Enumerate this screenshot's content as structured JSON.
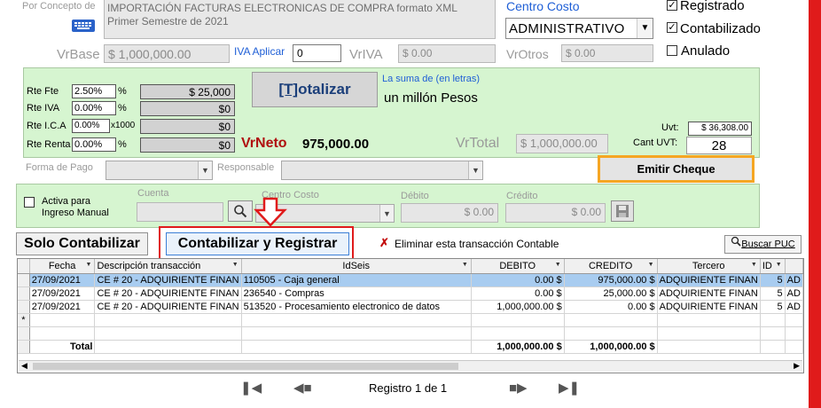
{
  "concepto": {
    "label": "Por Concepto de",
    "text_line1": "IMPORTACIÓN FACTURAS ELECTRONICAS DE COMPRA formato XML",
    "text_line2": "Primer Semestre de 2021",
    "keyboard_icon": "keyboard-icon"
  },
  "centro_costo_header": {
    "label": "Centro Costo",
    "value": "ADMINISTRATIVO"
  },
  "flags": {
    "registrado": {
      "label": "Registrado",
      "checked": true
    },
    "contabilizado": {
      "label": "Contabilizado",
      "checked": true
    },
    "anulado": {
      "label": "Anulado",
      "checked": false
    }
  },
  "base_row": {
    "vrbase_label": "VrBase",
    "vrbase_value": "$ 1,000,000.00",
    "iva_aplicar_label": "IVA Aplicar",
    "iva_aplicar_value": "0",
    "vriva_label": "VrIVA",
    "vriva_value": "$ 0.00",
    "vrotros_label": "VrOtros",
    "vrotros_value": "$ 0.00"
  },
  "retenciones": {
    "rte_fte": {
      "label": "Rte Fte",
      "pct": "2.50%",
      "unit": "%",
      "value": "$ 25,000"
    },
    "rte_iva": {
      "label": "Rte IVA",
      "pct": "0.00%",
      "unit": "%",
      "value": "$0"
    },
    "rte_ica": {
      "label": "Rte I.C.A",
      "pct": "0.00%",
      "unit": "x1000",
      "value": "$0"
    },
    "rte_renta": {
      "label": "Rte Renta",
      "pct": "0.00%",
      "unit": "%",
      "value": "$0"
    }
  },
  "totalizar_button": {
    "prefix": "[T]",
    "suffix": "otalizar"
  },
  "suma_letras": {
    "label": "La suma de (en letras)",
    "value": "un millón Pesos"
  },
  "vrneto": {
    "label": "VrNeto",
    "value": "975,000.00"
  },
  "vrtotal": {
    "label": "VrTotal",
    "value": "$ 1,000,000.00"
  },
  "uvt": {
    "label": "Uvt:",
    "value": "$ 36,308.00",
    "cant_label": "Cant UVT:",
    "cant_value": "28"
  },
  "forma_pago": {
    "label": "Forma de Pago",
    "value": ""
  },
  "responsable": {
    "label": "Responsable",
    "value": ""
  },
  "emitir_cheque": {
    "label": "Emitir Cheque"
  },
  "ingreso_manual": {
    "checkbox_label_line1": "Activa para",
    "checkbox_label_line2": "Ingreso Manual",
    "cuenta_label": "Cuenta",
    "centro_costo_label": "Centro Costo",
    "debito_label": "Débito",
    "debito_value": "$ 0.00",
    "credito_label": "Crédito",
    "credito_value": "$ 0.00"
  },
  "actions": {
    "solo_contabilizar": "Solo Contabilizar",
    "contabilizar_registrar": "Contabilizar y Registrar",
    "eliminar": "Eliminar esta transacción Contable",
    "buscar_puc": "Buscar PUC"
  },
  "grid": {
    "columns": [
      "Fecha",
      "Descripción transacción",
      "IdSeis",
      "DEBITO",
      "CREDITO",
      "Tercero",
      "ID"
    ],
    "rows": [
      {
        "fecha": "27/09/2021",
        "descripcion": "CE # 20 - ADQUIRIENTE  FINAN",
        "idseis": "110505 - Caja general",
        "debito": "0.00 $",
        "credito": "975,000.00 $",
        "tercero": "ADQUIRIENTE  FINAN",
        "id": "5",
        "extra": "AD"
      },
      {
        "fecha": "27/09/2021",
        "descripcion": "CE # 20 - ADQUIRIENTE  FINAN",
        "idseis": "236540 - Compras",
        "debito": "0.00 $",
        "credito": "25,000.00 $",
        "tercero": "ADQUIRIENTE  FINAN",
        "id": "5",
        "extra": "AD"
      },
      {
        "fecha": "27/09/2021",
        "descripcion": "CE # 20 - ADQUIRIENTE  FINAN",
        "idseis": "513520 - Procesamiento electronico de datos",
        "debito": "1,000,000.00 $",
        "credito": "0.00 $",
        "tercero": "ADQUIRIENTE  FINAN",
        "id": "5",
        "extra": "AD"
      }
    ],
    "new_row_marker": "*",
    "total_label": "Total",
    "total_debito": "1,000,000.00 $",
    "total_credito": "1,000,000.00 $"
  },
  "navigation": {
    "record_text": "Registro 1 de 1"
  },
  "colors": {
    "green_panel": "#d6f5d0",
    "red_accent": "#e01b1b",
    "vrneto_red": "#b01010",
    "link_blue": "#1f5fd6",
    "emitir_border": "#f5a623",
    "selected_row": "#a8ccf0"
  }
}
